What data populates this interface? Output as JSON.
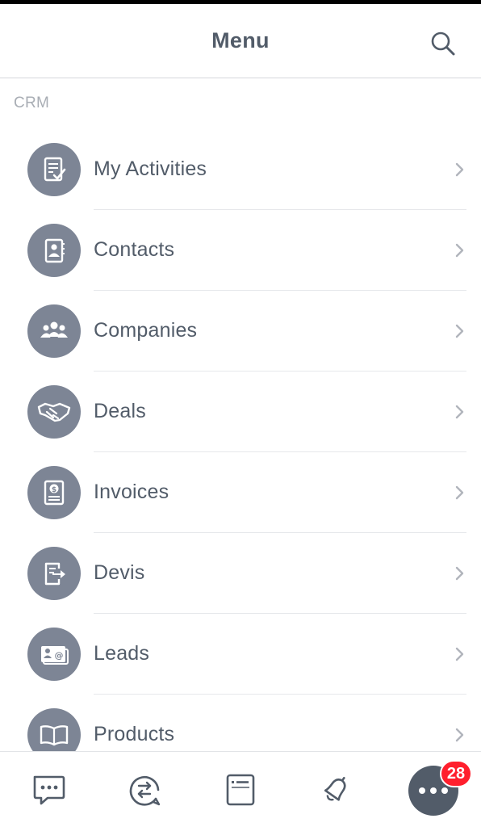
{
  "header": {
    "title": "Menu"
  },
  "section": {
    "label": "CRM"
  },
  "menu": {
    "items": [
      {
        "label": "My Activities",
        "icon": "activities-checklist-icon"
      },
      {
        "label": "Contacts",
        "icon": "contact-book-icon"
      },
      {
        "label": "Companies",
        "icon": "group-people-icon"
      },
      {
        "label": "Deals",
        "icon": "handshake-icon"
      },
      {
        "label": "Invoices",
        "icon": "invoice-dollar-icon"
      },
      {
        "label": "Devis",
        "icon": "quote-document-arrow-icon"
      },
      {
        "label": "Leads",
        "icon": "lead-card-at-icon"
      },
      {
        "label": "Products",
        "icon": "open-book-icon"
      }
    ]
  },
  "tabbar": {
    "tabs": [
      {
        "icon": "chat-bubble-icon"
      },
      {
        "icon": "feed-exchange-icon"
      },
      {
        "icon": "tasks-card-icon"
      },
      {
        "icon": "notification-bell-icon"
      },
      {
        "icon": "more-dots-icon"
      }
    ],
    "badge_count": "28"
  },
  "colors": {
    "text": "#525c69",
    "icon_circle": "#7d8595",
    "badge": "#ff1f2d",
    "section_label": "#a8adb4"
  }
}
